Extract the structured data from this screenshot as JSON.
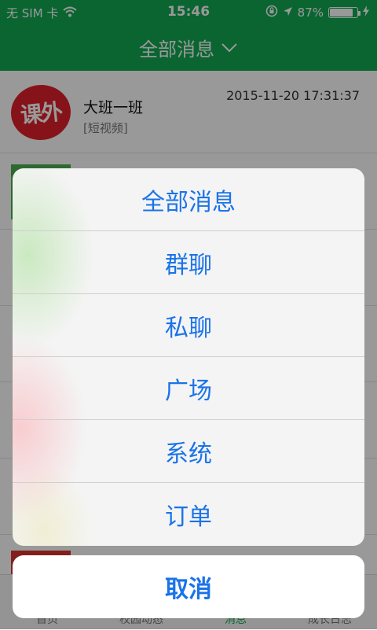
{
  "status_bar": {
    "carrier": "无 SIM 卡",
    "time": "15:46",
    "battery_percent": "87%",
    "battery_level": 0.87
  },
  "nav": {
    "title": "全部消息"
  },
  "list": [
    {
      "name": "大班一班",
      "subtitle": "[短视频]",
      "time": "2015-11-20 17:31:37",
      "avatar_text": "课外"
    }
  ],
  "action_sheet": {
    "items": [
      "全部消息",
      "群聊",
      "私聊",
      "广场",
      "系统",
      "订单"
    ],
    "cancel_label": "取消"
  },
  "tabbar": {
    "items": [
      "首页",
      "校园动态",
      "消息",
      "成长日志"
    ],
    "active_index": 2
  },
  "colors": {
    "brand_green": "#12a853",
    "action_blue": "#1a73e8"
  }
}
